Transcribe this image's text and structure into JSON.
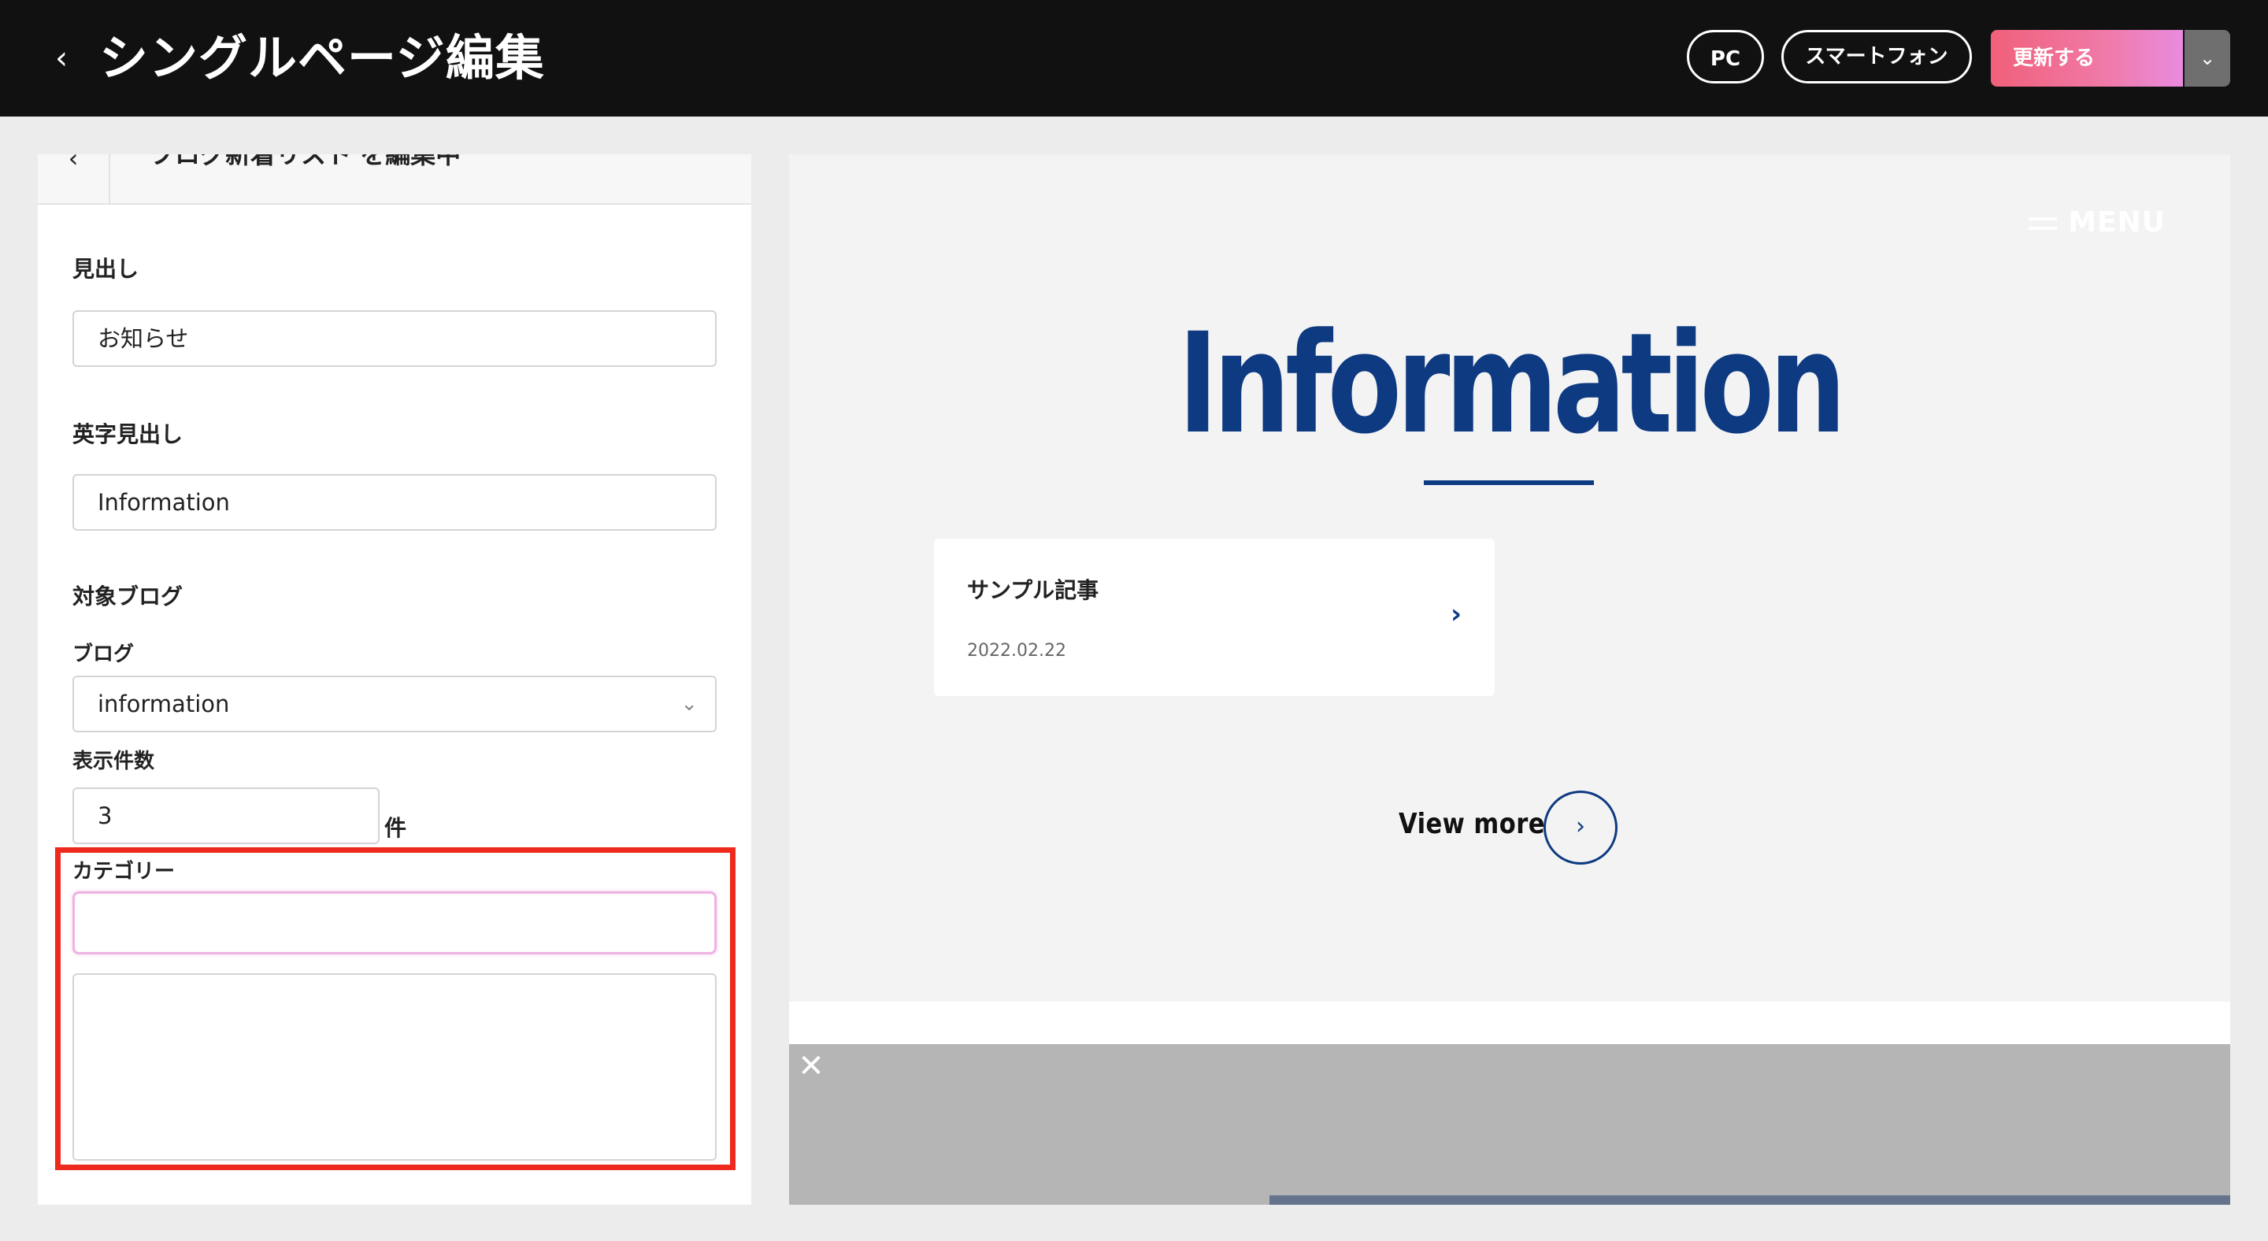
{
  "header": {
    "back_icon": "chevron-left-icon",
    "title": "シングルページ編集",
    "pc_label": "PC",
    "smartphone_label": "スマートフォン",
    "update_label": "更新する",
    "update_dropdown_icon": "chevron-down-icon",
    "accent_gradient": [
      "#f0607a",
      "#e98be0"
    ]
  },
  "panel": {
    "title": "ブログ新着リスト を編集中",
    "heading_label": "見出し",
    "heading_value": "お知らせ",
    "en_heading_label": "英字見出し",
    "en_heading_value": "Information",
    "target_blog_label": "対象ブログ",
    "blog_label": "ブログ",
    "blog_value": "information",
    "count_label": "表示件数",
    "count_value": "3",
    "count_unit": "件",
    "category_label": "カテゴリー",
    "category_value": "",
    "highlight_color": "#ee2a1f"
  },
  "preview": {
    "menu_label": "MENU",
    "title": "Information",
    "title_color": "#0e3a82",
    "card": {
      "title": "サンプル記事",
      "date": "2022.02.22"
    },
    "view_more": "View more",
    "progress": 0.67
  }
}
